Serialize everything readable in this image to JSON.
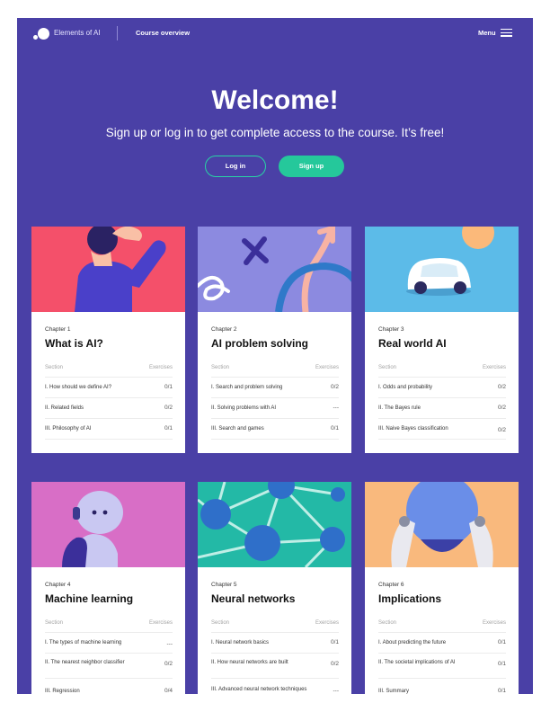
{
  "nav": {
    "brand": "Elements of AI",
    "course_link": "Course overview",
    "menu_label": "Menu"
  },
  "hero": {
    "title": "Welcome!",
    "subtitle": "Sign up or log in to get complete access to the course. It’s free!",
    "login_label": "Log in",
    "signup_label": "Sign up"
  },
  "table_headers": {
    "section": "Section",
    "exercises": "Exercises"
  },
  "chapters": [
    {
      "chapter": "Chapter 1",
      "title": "What is AI?",
      "image_bg": "#f4506a",
      "sections": [
        {
          "name": "I. How should we define AI?",
          "exercises": "0/1"
        },
        {
          "name": "II. Related fields",
          "exercises": "0/2"
        },
        {
          "name": "III. Philosophy of AI",
          "exercises": "0/1"
        }
      ]
    },
    {
      "chapter": "Chapter 2",
      "title": "AI problem solving",
      "image_bg": "#8c8ae0",
      "sections": [
        {
          "name": "I. Search and problem solving",
          "exercises": "0/2"
        },
        {
          "name": "II. Solving problems with AI",
          "exercises": "---"
        },
        {
          "name": "III. Search and games",
          "exercises": "0/1"
        }
      ]
    },
    {
      "chapter": "Chapter 3",
      "title": "Real world AI",
      "image_bg": "#5cbbe8",
      "sections": [
        {
          "name": "I. Odds and probability",
          "exercises": "0/2"
        },
        {
          "name": "II. The Bayes rule",
          "exercises": "0/2"
        },
        {
          "name": "III. Naive Bayes classification",
          "exercises": "0/2"
        }
      ]
    },
    {
      "chapter": "Chapter 4",
      "title": "Machine learning",
      "image_bg": "#d86ec6",
      "sections": [
        {
          "name": "I. The types of machine learning",
          "exercises": "---"
        },
        {
          "name": "II. The nearest neighbor classifier",
          "exercises": "0/2"
        },
        {
          "name": "III. Regression",
          "exercises": "0/4"
        }
      ]
    },
    {
      "chapter": "Chapter 5",
      "title": "Neural networks",
      "image_bg": "#23b9a6",
      "sections": [
        {
          "name": "I. Neural network basics",
          "exercises": "0/1"
        },
        {
          "name": "II. How neural networks are built",
          "exercises": "0/2"
        },
        {
          "name": "III. Advanced neural network techniques",
          "exercises": "---"
        }
      ]
    },
    {
      "chapter": "Chapter 6",
      "title": "Implications",
      "image_bg": "#f9b97d",
      "sections": [
        {
          "name": "I. About predicting the future",
          "exercises": "0/1"
        },
        {
          "name": "II. The societal implications of AI",
          "exercises": "0/1"
        },
        {
          "name": "III. Summary",
          "exercises": "0/1"
        }
      ]
    }
  ],
  "colors": {
    "page_bg": "#4a40a6",
    "accent_green": "#25c89b"
  }
}
